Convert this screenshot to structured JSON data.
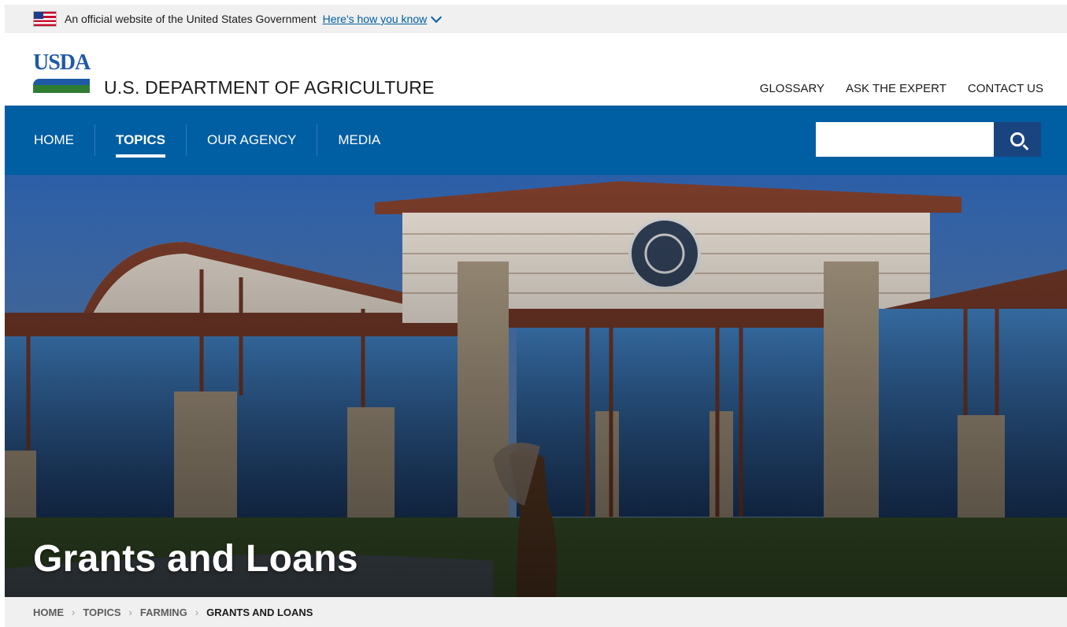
{
  "gov_banner": {
    "flag_icon": "us-flag-icon",
    "text": "An official website of the United States Government",
    "link": "Here's how you know"
  },
  "header": {
    "logo_text": "USDA",
    "department": "U.S. DEPARTMENT OF AGRICULTURE",
    "utility_nav": [
      "GLOSSARY",
      "ASK THE EXPERT",
      "CONTACT US"
    ]
  },
  "main_nav": {
    "items": [
      {
        "label": "HOME",
        "active": false
      },
      {
        "label": "TOPICS",
        "active": true
      },
      {
        "label": "OUR AGENCY",
        "active": false
      },
      {
        "label": "MEDIA",
        "active": false
      }
    ],
    "search": {
      "value": "",
      "placeholder": "",
      "icon": "search-icon"
    },
    "color": "#005ea2"
  },
  "hero": {
    "title": "Grants and Loans"
  },
  "breadcrumb": [
    "HOME",
    "TOPICS",
    "FARMING",
    "GRANTS AND LOANS"
  ]
}
